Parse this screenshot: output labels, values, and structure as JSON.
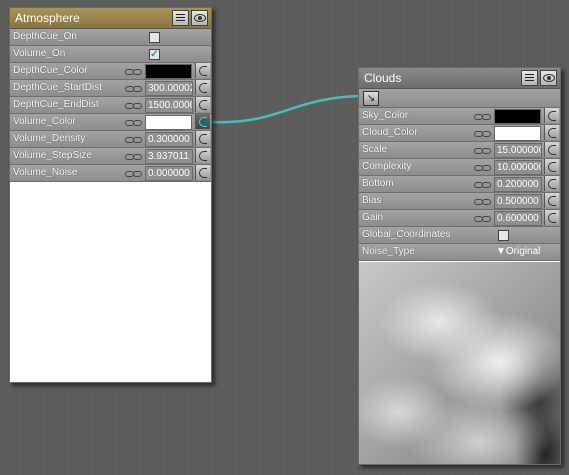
{
  "atmosphere": {
    "title": "Atmosphere",
    "rows": [
      {
        "label": "DepthCue_On",
        "kind": "checkbox",
        "checked": false
      },
      {
        "label": "Volume_On",
        "kind": "checkbox",
        "checked": true
      },
      {
        "label": "DepthCue_Color",
        "kind": "color",
        "color": "#000000"
      },
      {
        "label": "DepthCue_StartDist",
        "kind": "number",
        "value": "300.00002"
      },
      {
        "label": "DepthCue_EndDist",
        "kind": "number",
        "value": "1500.0000"
      },
      {
        "label": "Volume_Color",
        "kind": "color",
        "color": "#ffffff",
        "connected": true
      },
      {
        "label": "Volume_Density",
        "kind": "number",
        "value": "0.300000"
      },
      {
        "label": "Volume_StepSize",
        "kind": "number",
        "value": "3.937011"
      },
      {
        "label": "Volume_Noise",
        "kind": "number",
        "value": "0.000000"
      }
    ]
  },
  "clouds": {
    "title": "Clouds",
    "rows": [
      {
        "label": "Sky_Color",
        "kind": "color",
        "color": "#000000"
      },
      {
        "label": "Cloud_Color",
        "kind": "color",
        "color": "#ffffff"
      },
      {
        "label": "Scale",
        "kind": "number",
        "value": "15.000000"
      },
      {
        "label": "Complexity",
        "kind": "number",
        "value": "10.000000"
      },
      {
        "label": "Bottom",
        "kind": "number",
        "value": "0.200000"
      },
      {
        "label": "Bias",
        "kind": "number",
        "value": "0.500000"
      },
      {
        "label": "Gain",
        "kind": "number",
        "value": "0.600000"
      },
      {
        "label": "Global_Coordinates",
        "kind": "checkbox",
        "checked": false
      },
      {
        "label": "Noise_Type",
        "kind": "dropdown",
        "value": "Original"
      }
    ]
  },
  "icons": {
    "menu": "menu-icon",
    "eye": "eye-icon",
    "link": "link-icon",
    "plug": "input-plug-icon",
    "node": "node-output-icon"
  },
  "colors": {
    "atmosphere_title": "#9b864e",
    "clouds_title": "#7b7b7b",
    "connection_wire": "#3fbfbf",
    "checkmark": "#1a9fb0"
  }
}
